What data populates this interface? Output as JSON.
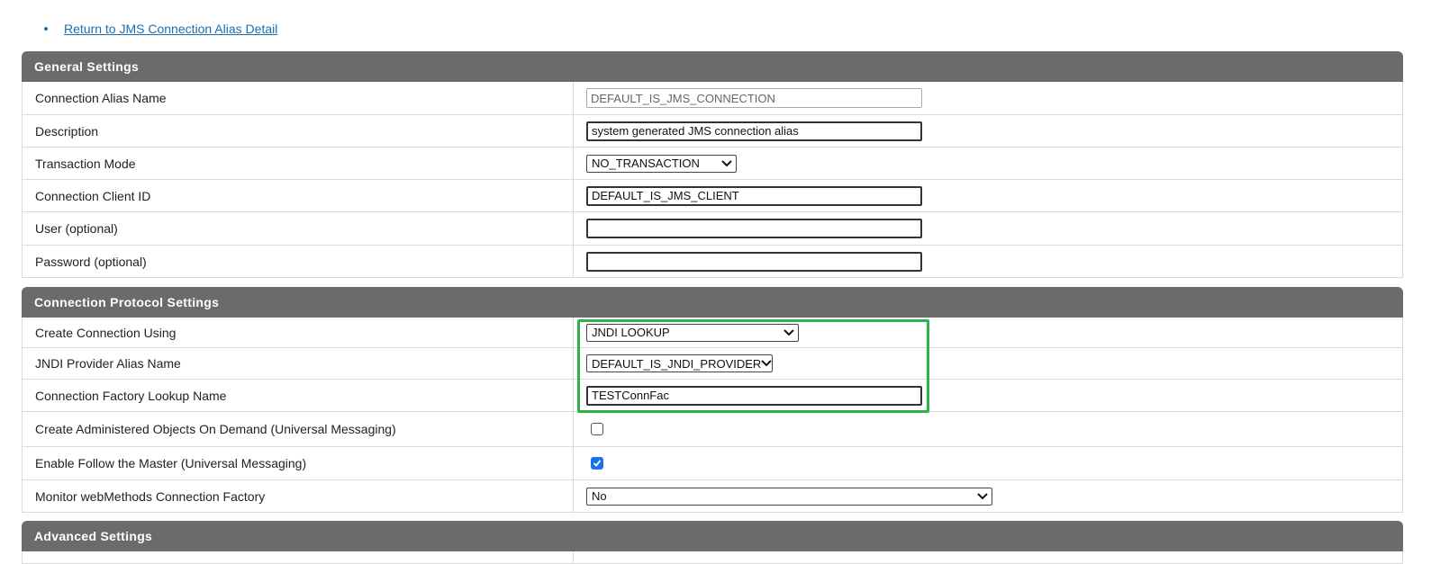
{
  "nav": {
    "return_link": "Return to JMS Connection Alias Detail"
  },
  "general": {
    "title": "General Settings",
    "alias_name_label": "Connection Alias Name",
    "alias_name_value": "DEFAULT_IS_JMS_CONNECTION",
    "description_label": "Description",
    "description_value": "system generated JMS connection alias",
    "transaction_mode_label": "Transaction Mode",
    "transaction_mode_value": "NO_TRANSACTION",
    "client_id_label": "Connection Client ID",
    "client_id_value": "DEFAULT_IS_JMS_CLIENT",
    "user_label": "User (optional)",
    "user_value": "",
    "password_label": "Password (optional)",
    "password_value": ""
  },
  "protocol": {
    "title": "Connection Protocol Settings",
    "create_using_label": "Create Connection Using",
    "create_using_value": "JNDI LOOKUP",
    "jndi_alias_label": "JNDI Provider Alias Name",
    "jndi_alias_value": "DEFAULT_IS_JNDI_PROVIDER",
    "factory_lookup_label": "Connection Factory Lookup Name",
    "factory_lookup_value": "TESTConnFac",
    "admin_objects_label": "Create Administered Objects On Demand (Universal Messaging)",
    "admin_objects_checked": false,
    "follow_master_label": "Enable Follow the Master (Universal Messaging)",
    "follow_master_checked": true,
    "monitor_factory_label": "Monitor webMethods Connection Factory",
    "monitor_factory_value": "No"
  },
  "advanced": {
    "title": "Advanced Settings"
  },
  "colors": {
    "header_bg": "#6b6b6b",
    "link": "#1a6fb0",
    "highlight": "#2db34a",
    "checkbox_on": "#1a73e8"
  }
}
